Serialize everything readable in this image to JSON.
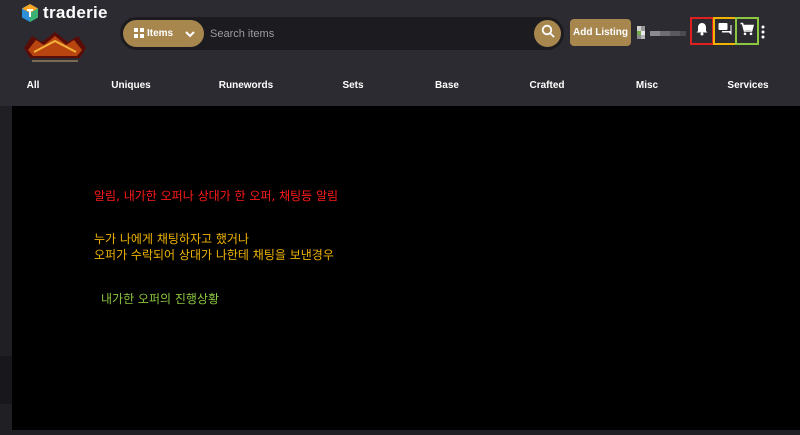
{
  "brand": {
    "name": "traderie"
  },
  "search": {
    "category_label": "Items",
    "placeholder": "Search items"
  },
  "header": {
    "add_listing_label": "Add Listing"
  },
  "nav": {
    "categories": [
      "All",
      "Uniques",
      "Runewords",
      "Sets",
      "Base",
      "Crafted",
      "Misc",
      "Services"
    ]
  },
  "annotations": {
    "red": "알림, 내가한 오퍼나 상대가 한 오퍼, 채팅등 알림",
    "yellow_line1": "누가 나에게 채팅하자고 했거나",
    "yellow_line2": "오퍼가 수락되어 상대가 나한테 채팅을 보낸경우",
    "green": "내가한 오퍼의 진행상황"
  },
  "colors": {
    "accent": "#a8874f",
    "header_bg": "#2b2b31",
    "bell_highlight": "#e02020",
    "chat_highlight": "#f0b400",
    "cart_highlight": "#8dc63f"
  },
  "icons": [
    "traderie-logo-icon",
    "diablo-logo",
    "grid-icon",
    "chevron-down-icon",
    "search-icon",
    "avatar",
    "bell-icon",
    "chat-icon",
    "cart-icon",
    "kebab-menu-icon"
  ]
}
